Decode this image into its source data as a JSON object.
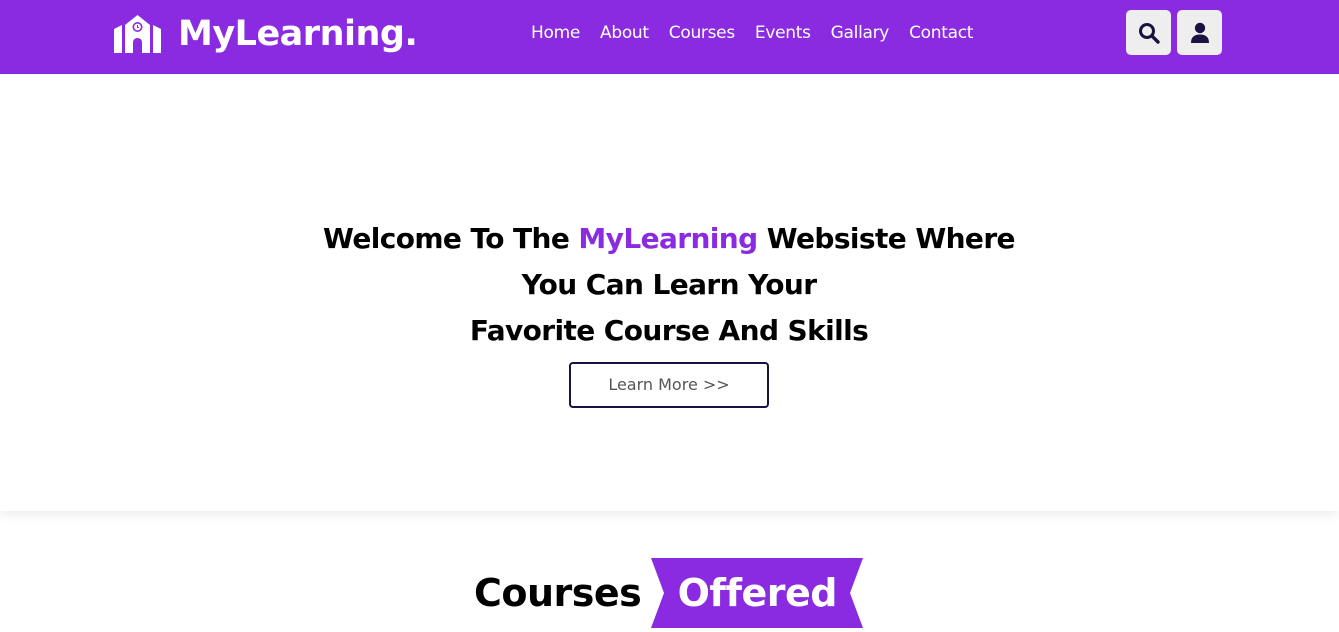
{
  "header": {
    "logo_text": "MyLearning.",
    "nav": [
      "Home",
      "About",
      "Courses",
      "Events",
      "Gallary",
      "Contact"
    ],
    "icons": [
      "school-icon",
      "search-icon",
      "user-icon"
    ],
    "colors": {
      "primary": "#8a2be2",
      "icon_button_bg": "#eeeeee",
      "icon_color": "#1a1240"
    }
  },
  "hero": {
    "title_pre": "Welcome To The ",
    "title_accent": "MyLearning",
    "title_post": " Websiste Where",
    "title_line2": "You Can Learn Your",
    "title_line3": "Favorite Course And Skills",
    "button_label": "Learn More >>"
  },
  "courses": {
    "title_part1": "Courses",
    "title_part2": "Offered"
  }
}
